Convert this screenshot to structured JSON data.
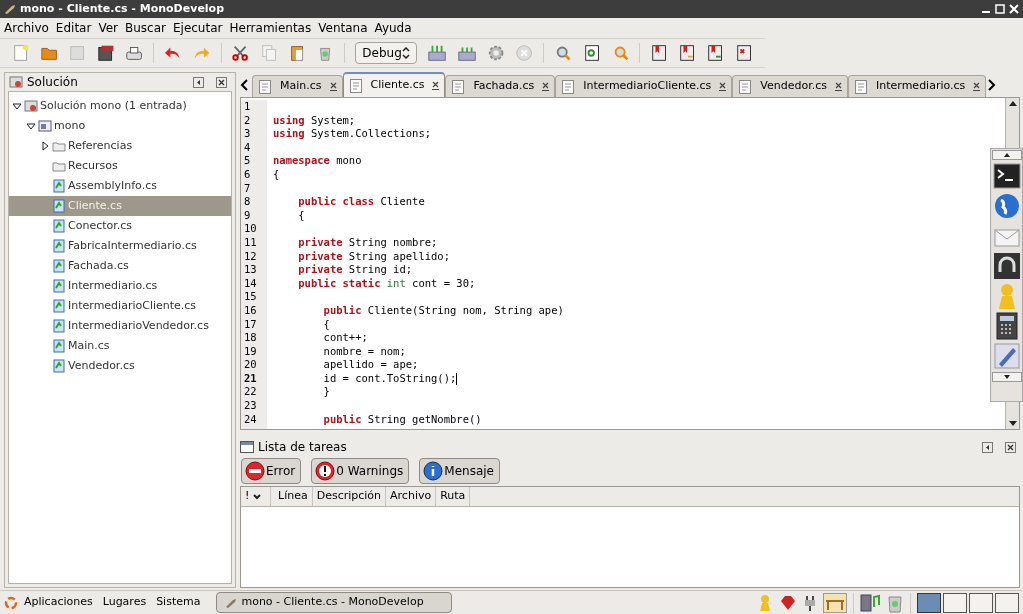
{
  "window": {
    "title": "mono - Cliente.cs - MonoDevelop"
  },
  "menu": [
    "Archivo",
    "Editar",
    "Ver",
    "Buscar",
    "Ejecutar",
    "Herramientas",
    "Ventana",
    "Ayuda"
  ],
  "toolbar": {
    "configuration": "Debug"
  },
  "solution_panel": {
    "title": "Solución",
    "tree": [
      {
        "label": "Solución mono (1 entrada)",
        "kind": "solution",
        "expanded": true,
        "selected": false,
        "children": [
          {
            "label": "mono",
            "kind": "project",
            "expanded": true,
            "selected": false,
            "children": [
              {
                "label": "Referencias",
                "kind": "folder",
                "expanded": false,
                "selected": false
              },
              {
                "label": "Recursos",
                "kind": "folder",
                "selected": false
              },
              {
                "label": "AssemblyInfo.cs",
                "kind": "file",
                "selected": false
              },
              {
                "label": "Cliente.cs",
                "kind": "file",
                "selected": true
              },
              {
                "label": "Conector.cs",
                "kind": "file",
                "selected": false
              },
              {
                "label": "FabricaIntermediario.cs",
                "kind": "file",
                "selected": false
              },
              {
                "label": "Fachada.cs",
                "kind": "file",
                "selected": false
              },
              {
                "label": "Intermediario.cs",
                "kind": "file",
                "selected": false
              },
              {
                "label": "IntermediarioCliente.cs",
                "kind": "file",
                "selected": false
              },
              {
                "label": "IntermediarioVendedor.cs",
                "kind": "file",
                "selected": false
              },
              {
                "label": "Main.cs",
                "kind": "file",
                "selected": false
              },
              {
                "label": "Vendedor.cs",
                "kind": "file",
                "selected": false
              }
            ]
          }
        ]
      }
    ]
  },
  "tabs": [
    {
      "label": "Main.cs",
      "selected": false
    },
    {
      "label": "Cliente.cs",
      "selected": true
    },
    {
      "label": "Fachada.cs",
      "selected": false
    },
    {
      "label": "IntermediarioCliente.cs",
      "selected": false
    },
    {
      "label": "Vendedor.cs",
      "selected": false
    },
    {
      "label": "Intermediario.cs",
      "selected": false
    }
  ],
  "editor": {
    "lines": [
      {
        "number": "1",
        "current": false
      },
      {
        "number": "2",
        "current": false,
        "tokens": [
          {
            "text": "using",
            "kind": "keyword"
          },
          {
            "text": " System;",
            "kind": "plain"
          }
        ]
      },
      {
        "number": "3",
        "current": false,
        "tokens": [
          {
            "text": "using",
            "kind": "keyword"
          },
          {
            "text": " System.Collections;",
            "kind": "plain"
          }
        ]
      },
      {
        "number": "4",
        "current": false
      },
      {
        "number": "5",
        "current": false,
        "tokens": [
          {
            "text": "namespace",
            "kind": "keyword"
          },
          {
            "text": " mono",
            "kind": "plain"
          }
        ]
      },
      {
        "number": "6",
        "current": false,
        "tokens": [
          {
            "text": "{",
            "kind": "plain"
          }
        ]
      },
      {
        "number": "7",
        "current": false
      },
      {
        "number": "8",
        "current": false,
        "tokens": [
          {
            "text": "    public class",
            "kind": "keyword"
          },
          {
            "text": " Cliente",
            "kind": "plain"
          }
        ]
      },
      {
        "number": "9",
        "current": false,
        "tokens": [
          {
            "text": "    {",
            "kind": "plain"
          }
        ]
      },
      {
        "number": "10",
        "current": false
      },
      {
        "number": "11",
        "current": false,
        "tokens": [
          {
            "text": "    private",
            "kind": "keyword"
          },
          {
            "text": " String nombre;",
            "kind": "plain"
          }
        ]
      },
      {
        "number": "12",
        "current": false,
        "tokens": [
          {
            "text": "    private",
            "kind": "keyword"
          },
          {
            "text": " String apellido;",
            "kind": "plain"
          }
        ]
      },
      {
        "number": "13",
        "current": false,
        "tokens": [
          {
            "text": "    private",
            "kind": "keyword"
          },
          {
            "text": " String id;",
            "kind": "plain"
          }
        ]
      },
      {
        "number": "14",
        "current": false,
        "tokens": [
          {
            "text": "    public static",
            "kind": "keyword"
          },
          {
            "text": " int",
            "kind": "type"
          },
          {
            "text": " cont = 30;",
            "kind": "plain"
          }
        ]
      },
      {
        "number": "15",
        "current": false
      },
      {
        "number": "16",
        "current": false,
        "tokens": [
          {
            "text": "        public",
            "kind": "keyword"
          },
          {
            "text": " Cliente(String nom, String ape)",
            "kind": "plain"
          }
        ]
      },
      {
        "number": "17",
        "current": false,
        "tokens": [
          {
            "text": "        {",
            "kind": "plain"
          }
        ]
      },
      {
        "number": "18",
        "current": false,
        "tokens": [
          {
            "text": "        cont++;",
            "kind": "plain"
          }
        ]
      },
      {
        "number": "19",
        "current": false,
        "tokens": [
          {
            "text": "        nombre = nom;",
            "kind": "plain"
          }
        ]
      },
      {
        "number": "20",
        "current": false,
        "tokens": [
          {
            "text": "        apellido = ape;",
            "kind": "plain"
          }
        ]
      },
      {
        "number": "21",
        "current": true,
        "tokens": [
          {
            "text": "        id = cont.ToString();",
            "kind": "plain"
          }
        ]
      },
      {
        "number": "22",
        "current": false,
        "tokens": [
          {
            "text": "        }",
            "kind": "plain"
          }
        ]
      },
      {
        "number": "23",
        "current": false
      },
      {
        "number": "24",
        "current": false,
        "tokens": [
          {
            "text": "        public",
            "kind": "keyword"
          },
          {
            "text": " String getNombre()",
            "kind": "plain"
          }
        ]
      }
    ]
  },
  "task_list": {
    "title": "Lista de tareas",
    "filters": [
      {
        "label": "Error",
        "kind": "error"
      },
      {
        "label": "0 Warnings",
        "kind": "warning"
      },
      {
        "label": "Mensaje",
        "kind": "info"
      }
    ],
    "columns": [
      "!",
      "Línea",
      "Descripción",
      "Archivo",
      "Ruta"
    ]
  },
  "taskbar": {
    "menus": [
      "Aplicaciones",
      "Lugares",
      "Sistema"
    ],
    "window_button": "mono - Cliente.cs - MonoDevelop",
    "workspaces": [
      {
        "selected": true
      },
      {
        "selected": false
      },
      {
        "selected": false
      },
      {
        "selected": false
      }
    ]
  }
}
